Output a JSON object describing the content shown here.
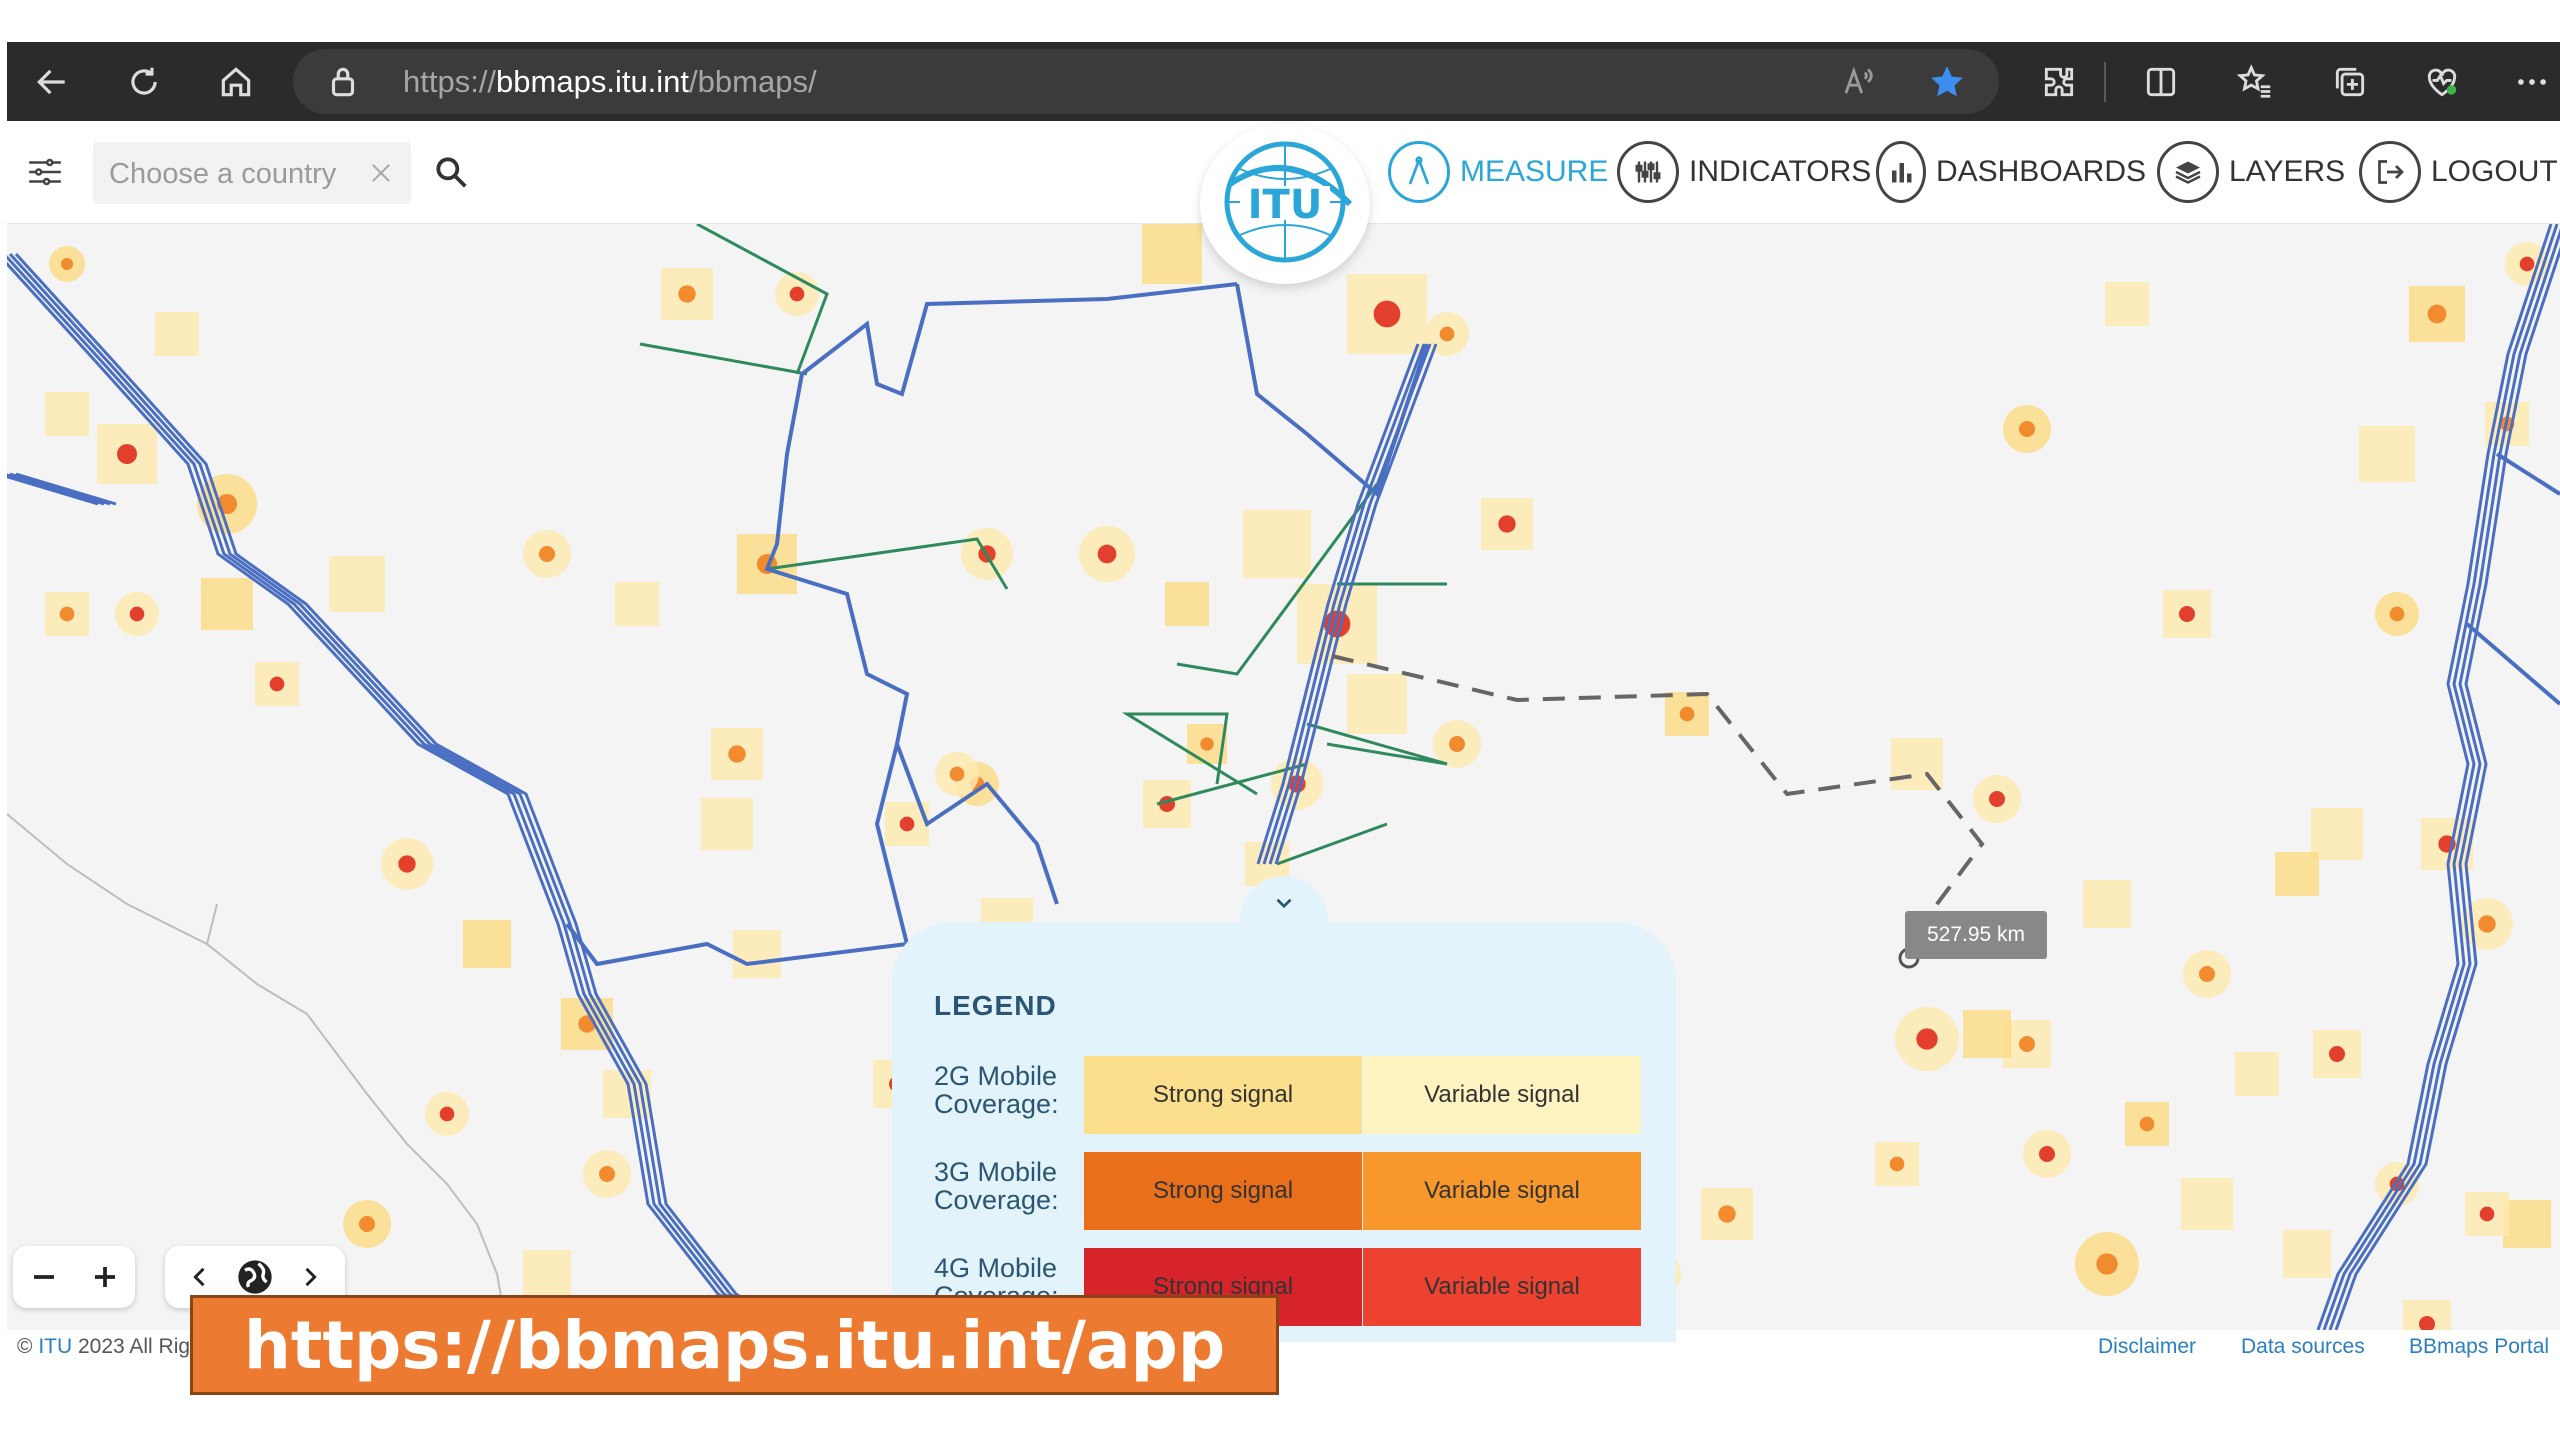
{
  "browser": {
    "url_scheme": "https://",
    "url_host": "bbmaps.itu.int",
    "url_path": "/bbmaps/"
  },
  "toolbar": {
    "country_placeholder": "Choose a country",
    "nav": [
      {
        "label": "MEASURE",
        "icon": "measure-icon",
        "active": true
      },
      {
        "label": "INDICATORS",
        "icon": "indicators-icon",
        "active": false
      },
      {
        "label": "DASHBOARDS",
        "icon": "dashboards-icon",
        "active": false
      },
      {
        "label": "LAYERS",
        "icon": "layers-icon",
        "active": false
      },
      {
        "label": "LOGOUT",
        "icon": "logout-icon",
        "active": false
      }
    ],
    "logo_text": "ITU"
  },
  "map": {
    "distance_label": "527.95 km"
  },
  "legend": {
    "title": "LEGEND",
    "rows": [
      {
        "label": "2G Mobile Coverage:",
        "strong": "Strong signal",
        "variable": "Variable signal",
        "strong_color": "#fcdf8c",
        "variable_color": "#fdf3c0"
      },
      {
        "label": "3G Mobile Coverage:",
        "strong": "Strong signal",
        "variable": "Variable signal",
        "strong_color": "#ea6f1b",
        "variable_color": "#f8982c"
      },
      {
        "label": "4G Mobile Coverage:",
        "strong": "Strong signal",
        "variable": "Variable signal",
        "strong_color": "#d6242a",
        "variable_color": "#ee4231"
      }
    ]
  },
  "footer": {
    "copyright_prefix": "© ",
    "copyright_link": "ITU",
    "copyright_suffix": " 2023 All Rig",
    "links": [
      "Disclaimer",
      "Data sources",
      "BBmaps Portal"
    ]
  },
  "banner": {
    "text": "https://bbmaps.itu.int/app"
  },
  "colors": {
    "accent": "#2aa7d8",
    "cable_blue": "#4a6fc2",
    "cable_green": "#2e8a5c",
    "banner": "#ec7a31"
  }
}
